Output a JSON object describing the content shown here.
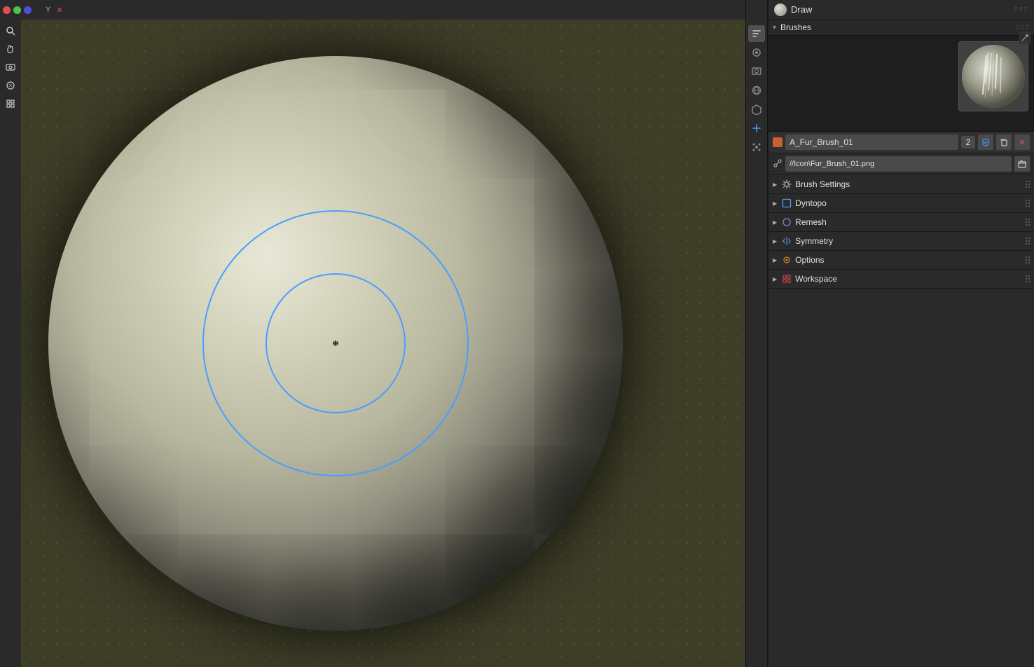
{
  "header": {
    "title": "Draw",
    "dots": [
      {
        "color": "#e05050",
        "name": "red-dot"
      },
      {
        "color": "#50c050",
        "name": "green-dot"
      },
      {
        "color": "#5050e0",
        "name": "blue-dot"
      }
    ]
  },
  "viewport": {
    "brush_cursor": {
      "outer_radius": 190,
      "inner_radius": 100
    }
  },
  "toolbar": {
    "left_tools": [
      {
        "icon": "⊕",
        "name": "add-tool",
        "active": false
      },
      {
        "icon": "🖐",
        "name": "grab-tool",
        "active": false
      },
      {
        "icon": "🎥",
        "name": "camera-tool",
        "active": false
      },
      {
        "icon": "⚙",
        "name": "settings-tool",
        "active": false
      },
      {
        "icon": "⊞",
        "name": "grid-tool",
        "active": false
      },
      {
        "icon": "✦",
        "name": "extras-tool",
        "active": false
      }
    ],
    "nav_tools": [
      {
        "icon": "🔧",
        "name": "wrench-icon",
        "active": true
      },
      {
        "icon": "📂",
        "name": "scene-icon",
        "active": false
      },
      {
        "icon": "🖼",
        "name": "render-icon",
        "active": false
      },
      {
        "icon": "⚙",
        "name": "world-icon",
        "active": false
      },
      {
        "icon": "👤",
        "name": "object-icon",
        "active": false
      },
      {
        "icon": "🔗",
        "name": "modifier-icon",
        "active": false
      },
      {
        "icon": "💠",
        "name": "data-icon",
        "active": false
      }
    ]
  },
  "brushes": {
    "section_label": "Brushes",
    "brush_name": "A_Fur_Brush_01",
    "brush_count": "2",
    "brush_path": "//Icon\\Fur_Brush_01.png",
    "color": "#c86030"
  },
  "panel_sections": [
    {
      "key": "brush_settings",
      "label": "Brush Settings",
      "icon": "⚙",
      "icon_color": "#aaaaaa",
      "collapsed": false
    },
    {
      "key": "dyntopo",
      "label": "Dyntopo",
      "icon": "□",
      "icon_color": "#4a9eff",
      "has_checkbox": true,
      "collapsed": false
    },
    {
      "key": "remesh",
      "label": "Remesh",
      "icon": "○",
      "icon_color": "#9080d0",
      "collapsed": false
    },
    {
      "key": "symmetry",
      "label": "Symmetry",
      "icon": "⬡",
      "icon_color": "#5090d0",
      "collapsed": false
    },
    {
      "key": "options",
      "label": "Options",
      "icon": "⊙",
      "icon_color": "#d08030",
      "collapsed": false
    },
    {
      "key": "workspace",
      "label": "Workspace",
      "icon": "⊞",
      "icon_color": "#d04040",
      "collapsed": false
    }
  ]
}
